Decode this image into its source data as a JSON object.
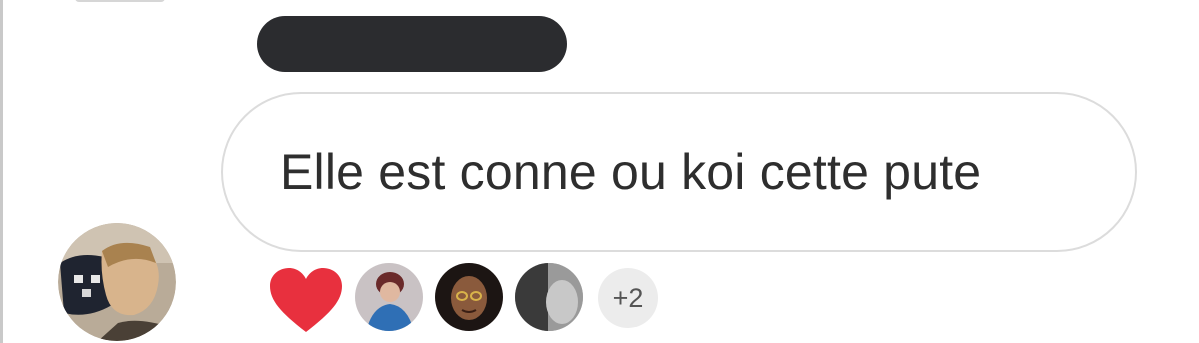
{
  "message": {
    "text": "Elle est conne ou koi cette pute"
  },
  "reactions": {
    "heart_icon": "heart-icon",
    "more_count": "+2"
  },
  "colors": {
    "bubble_border": "#dcdcdc",
    "redaction": "#2b2c2f",
    "heart": "#e8303e",
    "text": "#2e2e2e"
  }
}
